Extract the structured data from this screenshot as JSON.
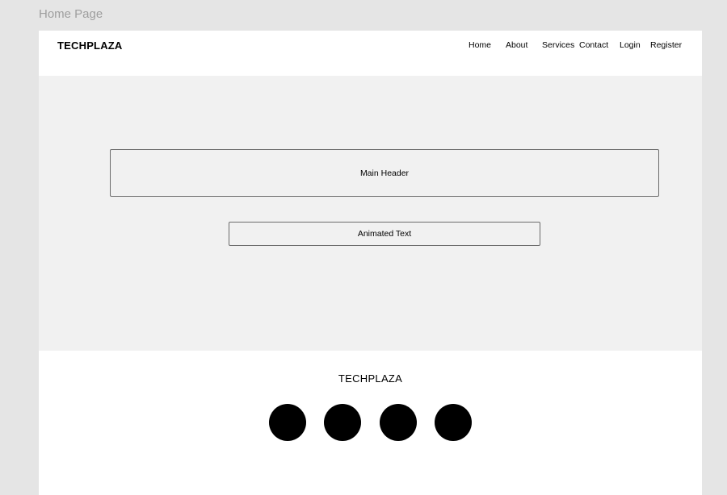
{
  "frame": {
    "label": "Home Page"
  },
  "navbar": {
    "brand": "TECHPLAZA",
    "links": [
      {
        "label": "Home"
      },
      {
        "label": "About"
      },
      {
        "label": "Services"
      },
      {
        "label": "Contact"
      },
      {
        "label": "Login"
      },
      {
        "label": "Register"
      }
    ]
  },
  "hero": {
    "main_header": "Main Header",
    "animated_text": "Animated Text"
  },
  "footer": {
    "brand": "TECHPLAZA",
    "social_icons": [
      {
        "icon": "social-circle-icon"
      },
      {
        "icon": "social-circle-icon"
      },
      {
        "icon": "social-circle-icon"
      },
      {
        "icon": "social-circle-icon"
      }
    ]
  },
  "colors": {
    "canvas": "#e5e5e5",
    "hero_background": "#f1f1f1",
    "border": "#6b6b6b",
    "text": "#000000",
    "frame_label": "#9e9e9e"
  }
}
